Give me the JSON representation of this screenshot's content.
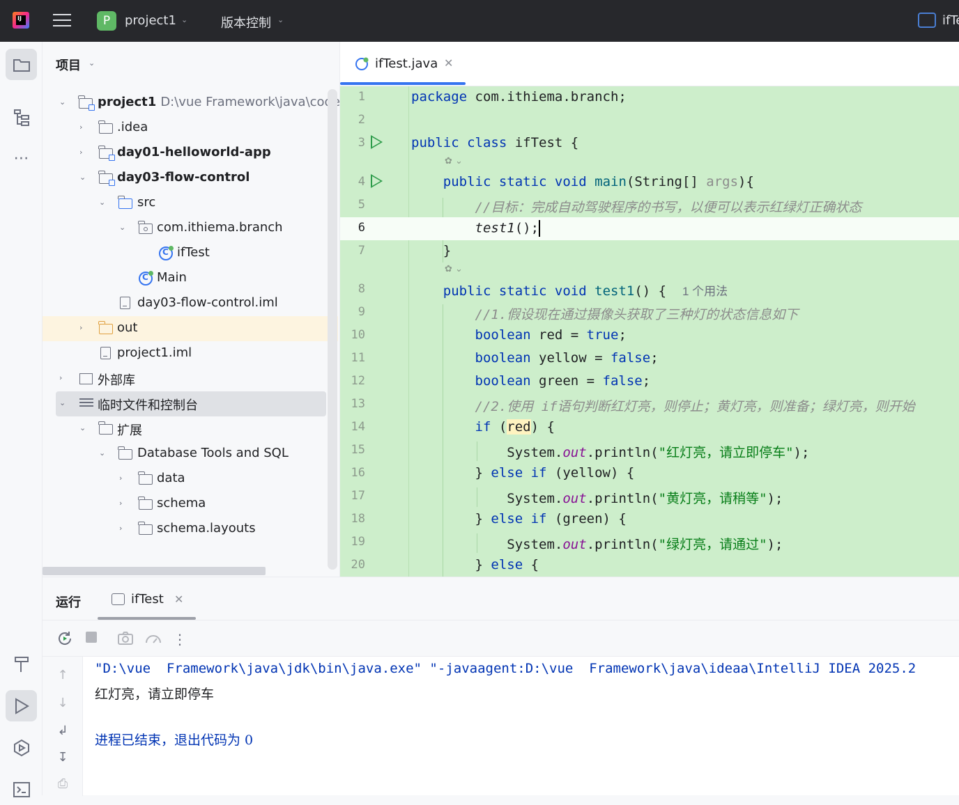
{
  "titlebar": {
    "project_badge": "P",
    "project_name": "project1",
    "vcs_label": "版本控制",
    "right_label": "ifTe"
  },
  "sidebar": {
    "title": "项目",
    "tree": [
      {
        "label": "project1",
        "path": "D:\\vue  Framework\\java\\code\\p",
        "bold": true,
        "expanded": true
      },
      {
        "label": ".idea",
        "expanded": false
      },
      {
        "label": "day01-helloworld-app",
        "bold": true,
        "expanded": false
      },
      {
        "label": "day03-flow-control",
        "bold": true,
        "expanded": true
      },
      {
        "label": "src",
        "expanded": true
      },
      {
        "label": "com.ithiema.branch",
        "expanded": true
      },
      {
        "label": "ifTest"
      },
      {
        "label": "Main"
      },
      {
        "label": "day03-flow-control.iml"
      },
      {
        "label": "out",
        "expanded": false
      },
      {
        "label": "project1.iml"
      },
      {
        "label": "外部库",
        "expanded": false
      },
      {
        "label": "临时文件和控制台",
        "expanded": true
      },
      {
        "label": "扩展",
        "expanded": true
      },
      {
        "label": "Database Tools and SQL",
        "expanded": true
      },
      {
        "label": "data",
        "expanded": false
      },
      {
        "label": "schema",
        "expanded": false
      },
      {
        "label": "schema.layouts",
        "expanded": false
      }
    ]
  },
  "editor": {
    "tab_label": "ifTest.java",
    "usage_hint": "1 个用法",
    "line_numbers": [
      "1",
      "2",
      "3",
      "4",
      "5",
      "6",
      "7",
      "8",
      "9",
      "10",
      "11",
      "12",
      "13",
      "14",
      "15",
      "16",
      "17",
      "18",
      "19",
      "20"
    ]
  },
  "code": {
    "l1_kw": "package",
    "l1_rest": " com.ithiema.branch;",
    "l3_kw": "public class",
    "l3_rest": " ifTest {",
    "l4_kw": "public static void",
    "l4_fn": "main",
    "l4_a": "(String[] ",
    "l4_par": "args",
    "l4_b": "){",
    "l5": "//目标：完成自动驾驶程序的书写，以便可以表示红绿灯正确状态",
    "l6": "test1",
    "l6_rest": "();",
    "l7": "}",
    "l8_kw": "public static void",
    "l8_fn": "test1",
    "l8_rest": "() {",
    "l9": "//1.假设现在通过摄像头获取了三种灯的状态信息如下",
    "l10_kw": "boolean",
    "l10_a": " red = ",
    "l10_v": "true",
    "l10_b": ";",
    "l11_kw": "boolean",
    "l11_a": " yellow = ",
    "l11_v": "false",
    "l11_b": ";",
    "l12_kw": "boolean",
    "l12_a": " green = ",
    "l12_v": "false",
    "l12_b": ";",
    "l13": "//2.使用 if语句判断红灯亮，则停止；黄灯亮，则准备；绿灯亮，则开始",
    "l14_kw": "if",
    "l14_a": " (",
    "l14_var": "red",
    "l14_b": ") {",
    "l15_a": "System.",
    "l15_f": "out",
    "l15_b": ".println(",
    "l15_s": "\"红灯亮，请立即停车\"",
    "l15_c": ");",
    "l16_a": "} ",
    "l16_kw": "else if",
    "l16_b": " (yellow) {",
    "l17_a": "System.",
    "l17_f": "out",
    "l17_b": ".println(",
    "l17_s": "\"黄灯亮，请稍等\"",
    "l17_c": ");",
    "l18_a": "} ",
    "l18_kw": "else if",
    "l18_b": " (green) {",
    "l19_a": "System.",
    "l19_f": "out",
    "l19_b": ".println(",
    "l19_s": "\"绿灯亮，请通过\"",
    "l19_c": ");",
    "l20_a": "} ",
    "l20_kw": "else",
    "l20_b": " {"
  },
  "run_panel": {
    "title": "运行",
    "tab_label": "ifTest",
    "console": [
      "\"D:\\vue  Framework\\java\\jdk\\bin\\java.exe\" \"-javaagent:D:\\vue  Framework\\java\\ideaa\\IntelliJ IDEA 2025.2",
      "红灯亮，请立即停车",
      "进程已结束，退出代码为 0"
    ]
  }
}
